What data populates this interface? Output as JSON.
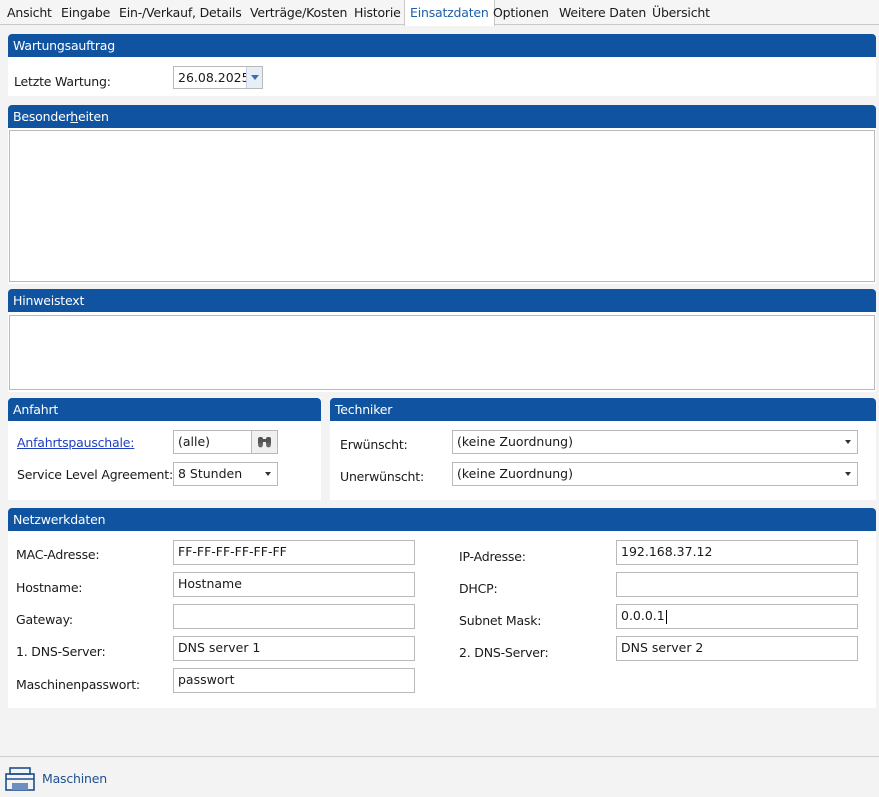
{
  "tabs": [
    {
      "label": "Ansicht"
    },
    {
      "label": "Eingabe"
    },
    {
      "label": "Ein-/Verkauf, Details"
    },
    {
      "label": "Verträge/Kosten"
    },
    {
      "label": "Historie"
    },
    {
      "label": "Einsatzdaten",
      "active": true
    },
    {
      "label": "Optionen"
    },
    {
      "label": "Weitere Daten"
    },
    {
      "label": "Übersicht"
    }
  ],
  "wartung": {
    "title": "Wartungsauftrag",
    "letzte_label": "Letzte Wartung:",
    "letzte_value": "26.08.2025"
  },
  "besonderheiten": {
    "title_pre": "Besonder",
    "title_accel": "h",
    "title_post": "eiten"
  },
  "hinweis": {
    "title": "Hinweistext"
  },
  "anfahrt": {
    "title": "Anfahrt",
    "pauschale_label": "Anfahrtspauschale:",
    "pauschale_value": "(alle)",
    "sla_label": "Service Level Agreement:",
    "sla_value": "8 Stunden"
  },
  "techniker": {
    "title": "Techniker",
    "erwuenscht_label": "Erwünscht:",
    "erwuenscht_value": "(keine Zuordnung)",
    "unerwuenscht_label": "Unerwünscht:",
    "unerwuenscht_value": "(keine Zuordnung)"
  },
  "netzwerk": {
    "title": "Netzwerkdaten",
    "mac_label": "MAC-Adresse:",
    "mac_value": "FF-FF-FF-FF-FF-FF",
    "hostname_label": "Hostname:",
    "hostname_value": "Hostname",
    "gateway_label": "Gateway:",
    "gateway_value": "",
    "dns1_label": "1. DNS-Server:",
    "dns1_value": "DNS server 1",
    "passwort_label": "Maschinenpasswort:",
    "passwort_value": "passwort",
    "ip_label": "IP-Adresse:",
    "ip_value": "192.168.37.12",
    "dhcp_label": "DHCP:",
    "dhcp_value": "",
    "subnet_label": "Subnet Mask:",
    "subnet_value": "0.0.0.1",
    "dns2_label": "2. DNS-Server:",
    "dns2_value": "DNS server 2"
  },
  "footer": {
    "maschinen_label": "Maschinen",
    "maschinen_icon": "printer-icon"
  }
}
